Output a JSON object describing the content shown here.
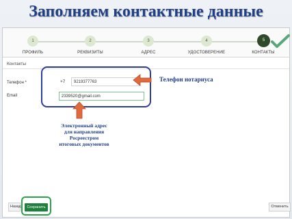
{
  "slide_title": "Заполняем контактные данные",
  "steps": [
    {
      "number": "1",
      "label": "ПРОФИЛЬ"
    },
    {
      "number": "2",
      "label": "РЕКВИЗИТЫ"
    },
    {
      "number": "3",
      "label": "АДРЕС"
    },
    {
      "number": "4",
      "label": "УДОСТОВЕРЕНИЕ"
    },
    {
      "number": "5",
      "label": "КОНТАКТЫ"
    }
  ],
  "section_title": "Контакты",
  "phone": {
    "label": "Телефон *",
    "prefix": "+7",
    "value": "9219377763"
  },
  "email": {
    "label": "Email",
    "value": "2339520@gmail.com"
  },
  "annotations": {
    "phone_note": "Телефон нотариуса",
    "email_note_lines": [
      "Электронный адрес",
      "для направления",
      "Росреестром",
      "итоговых документов"
    ]
  },
  "buttons": {
    "back": "Назад",
    "save": "Сохранить",
    "cancel": "Отменить"
  },
  "colors": {
    "title": "#1f3f86",
    "highlight_blue": "#2c3c9c",
    "highlight_green": "#2aa54a",
    "arrow": "#e06a3c",
    "save_button": "#1f7f3c",
    "active_step": "#2f4a2a"
  },
  "icons": [
    "checkmark-icon",
    "arrow-left-icon",
    "arrow-up-icon"
  ]
}
